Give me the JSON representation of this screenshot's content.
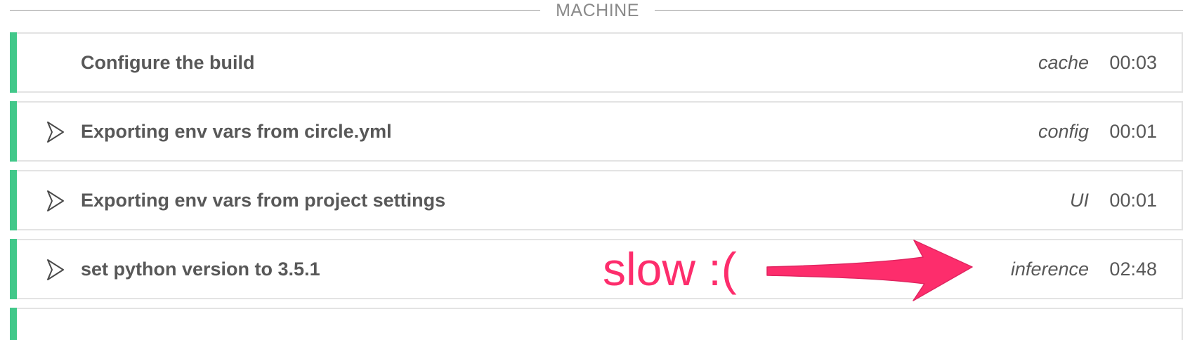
{
  "section": {
    "title": "MACHINE"
  },
  "steps": [
    {
      "name": "Configure the build",
      "source": "cache",
      "time": "00:03",
      "expandable": false
    },
    {
      "name": "Exporting env vars from circle.yml",
      "source": "config",
      "time": "00:01",
      "expandable": true
    },
    {
      "name": "Exporting env vars from project settings",
      "source": "UI",
      "time": "00:01",
      "expandable": true
    },
    {
      "name": "set python version to 3.5.1",
      "source": "inference",
      "time": "02:48",
      "expandable": true
    }
  ],
  "annotation": {
    "text": "slow :(",
    "color": "#fd2d6c"
  },
  "colors": {
    "status_success": "#42c88a",
    "text": "#585858",
    "muted": "#8a8a8a",
    "border": "#e3e3e3"
  },
  "icons": {
    "expand": "chevron-right-icon",
    "annotation": "arrow-right-icon"
  }
}
